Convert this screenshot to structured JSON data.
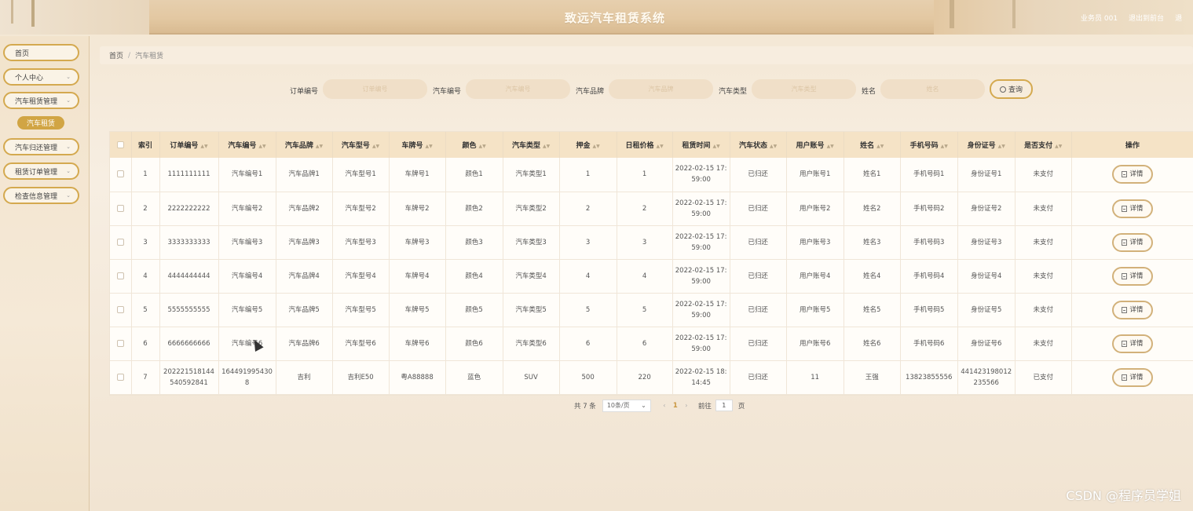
{
  "app": {
    "title": "致远汽车租赁系统"
  },
  "header": {
    "user_links": [
      "业务员 001",
      "退出到前台",
      "退"
    ]
  },
  "sidebar": {
    "items": [
      {
        "label": "首页",
        "has_arrow": false
      },
      {
        "label": "个人中心",
        "has_arrow": true
      },
      {
        "label": "汽车租赁管理",
        "has_arrow": true
      },
      {
        "label": "汽车归还管理",
        "has_arrow": true
      },
      {
        "label": "租赁订单管理",
        "has_arrow": true
      },
      {
        "label": "检查信息管理",
        "has_arrow": true
      }
    ],
    "active_subitem": "汽车租赁"
  },
  "breadcrumb": {
    "home": "首页",
    "separator": "/",
    "current": "汽车租赁"
  },
  "search": {
    "fields": [
      {
        "label": "订单编号",
        "placeholder": "订单编号"
      },
      {
        "label": "汽车编号",
        "placeholder": "汽车编号"
      },
      {
        "label": "汽车品牌",
        "placeholder": "汽车品牌"
      },
      {
        "label": "汽车类型",
        "placeholder": "汽车类型"
      },
      {
        "label": "姓名",
        "placeholder": "姓名"
      }
    ],
    "button_label": "查询"
  },
  "table": {
    "headers": [
      "索引",
      "订单编号",
      "汽车编号",
      "汽车品牌",
      "汽车型号",
      "车牌号",
      "颜色",
      "汽车类型",
      "押金",
      "日租价格",
      "租赁时间",
      "汽车状态",
      "用户账号",
      "姓名",
      "手机号码",
      "身份证号",
      "是否支付",
      "操作"
    ],
    "detail_label": "详情",
    "rows": [
      [
        "1",
        "1111111111",
        "汽车编号1",
        "汽车品牌1",
        "汽车型号1",
        "车牌号1",
        "颜色1",
        "汽车类型1",
        "1",
        "1",
        "2022-02-15 17:59:00",
        "已归还",
        "用户账号1",
        "姓名1",
        "手机号码1",
        "身份证号1",
        "未支付"
      ],
      [
        "2",
        "2222222222",
        "汽车编号2",
        "汽车品牌2",
        "汽车型号2",
        "车牌号2",
        "颜色2",
        "汽车类型2",
        "2",
        "2",
        "2022-02-15 17:59:00",
        "已归还",
        "用户账号2",
        "姓名2",
        "手机号码2",
        "身份证号2",
        "未支付"
      ],
      [
        "3",
        "3333333333",
        "汽车编号3",
        "汽车品牌3",
        "汽车型号3",
        "车牌号3",
        "颜色3",
        "汽车类型3",
        "3",
        "3",
        "2022-02-15 17:59:00",
        "已归还",
        "用户账号3",
        "姓名3",
        "手机号码3",
        "身份证号3",
        "未支付"
      ],
      [
        "4",
        "4444444444",
        "汽车编号4",
        "汽车品牌4",
        "汽车型号4",
        "车牌号4",
        "颜色4",
        "汽车类型4",
        "4",
        "4",
        "2022-02-15 17:59:00",
        "已归还",
        "用户账号4",
        "姓名4",
        "手机号码4",
        "身份证号4",
        "未支付"
      ],
      [
        "5",
        "5555555555",
        "汽车编号5",
        "汽车品牌5",
        "汽车型号5",
        "车牌号5",
        "颜色5",
        "汽车类型5",
        "5",
        "5",
        "2022-02-15 17:59:00",
        "已归还",
        "用户账号5",
        "姓名5",
        "手机号码5",
        "身份证号5",
        "未支付"
      ],
      [
        "6",
        "6666666666",
        "汽车编号6",
        "汽车品牌6",
        "汽车型号6",
        "车牌号6",
        "颜色6",
        "汽车类型6",
        "6",
        "6",
        "2022-02-15 17:59:00",
        "已归还",
        "用户账号6",
        "姓名6",
        "手机号码6",
        "身份证号6",
        "未支付"
      ],
      [
        "7",
        "202221518144540592841",
        "1644919954308",
        "吉利",
        "吉利E50",
        "粤A88888",
        "蓝色",
        "SUV",
        "500",
        "220",
        "2022-02-15 18:14:45",
        "已归还",
        "11",
        "王强",
        "13823855556",
        "441423198012235566",
        "已支付"
      ]
    ]
  },
  "pagination": {
    "total_text": "共 7 条",
    "page_size": "10条/页",
    "current_page": "1",
    "goto_label": "前往",
    "goto_value": "1",
    "page_unit": "页"
  },
  "watermark": "CSDN @程序员学姐",
  "colors": {
    "accent": "#d4a94f",
    "active_menu": "#d1a544",
    "header_bg": "#e3c8a2",
    "table_header": "#f5e3c6"
  }
}
